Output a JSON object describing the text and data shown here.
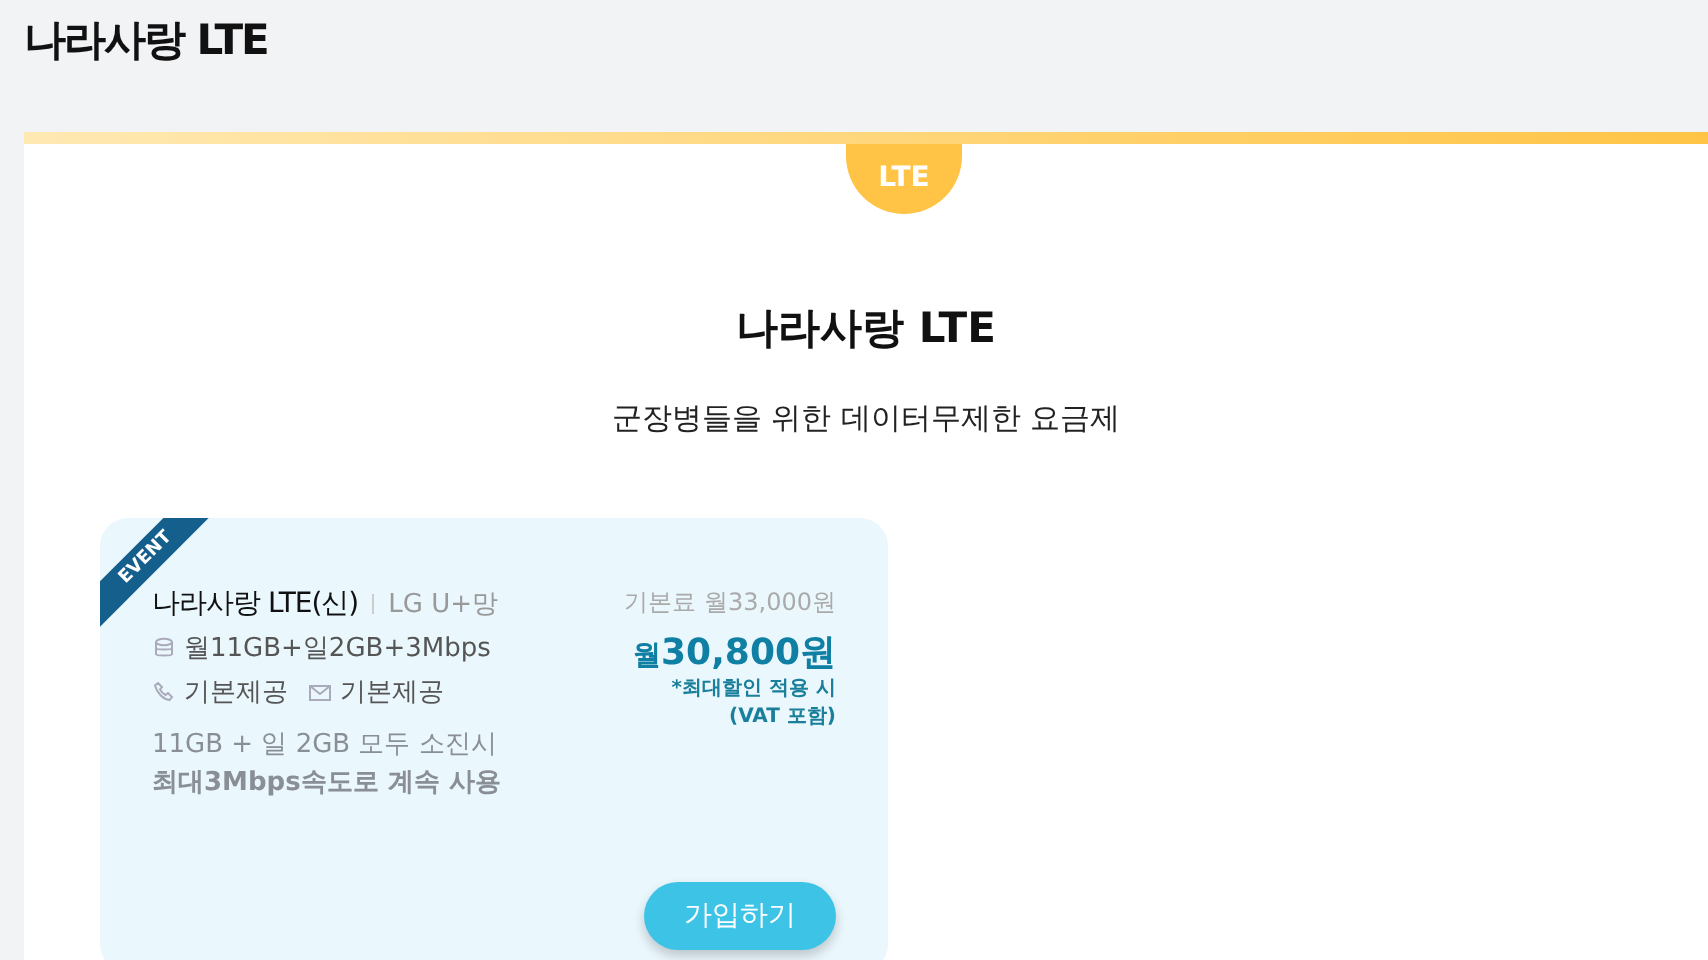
{
  "page_title": "나라사랑 LTE",
  "section": {
    "tab": "LTE",
    "title": "나라사랑 LTE",
    "subtitle": "군장병들을 위한 데이터무제한 요금제"
  },
  "plans": [
    {
      "ribbon": "EVENT",
      "name": "나라사랑 LTE(신)",
      "network": "LG U+망",
      "data": "월11GB+일2GB+3Mbps",
      "voice": "기본제공",
      "sms": "기본제공",
      "notes": [
        {
          "text": "11GB + 일 2GB 모두 소진시",
          "bold": false
        },
        {
          "text": "최대3Mbps속도로 계속 사용",
          "bold": true
        }
      ],
      "base_price": "기본료 월33,000원",
      "price_prefix": "월",
      "price": "30,800원",
      "price_notes": [
        "*최대할인 적용 시",
        "(VAT 포함)"
      ],
      "button": "가입하기"
    }
  ]
}
